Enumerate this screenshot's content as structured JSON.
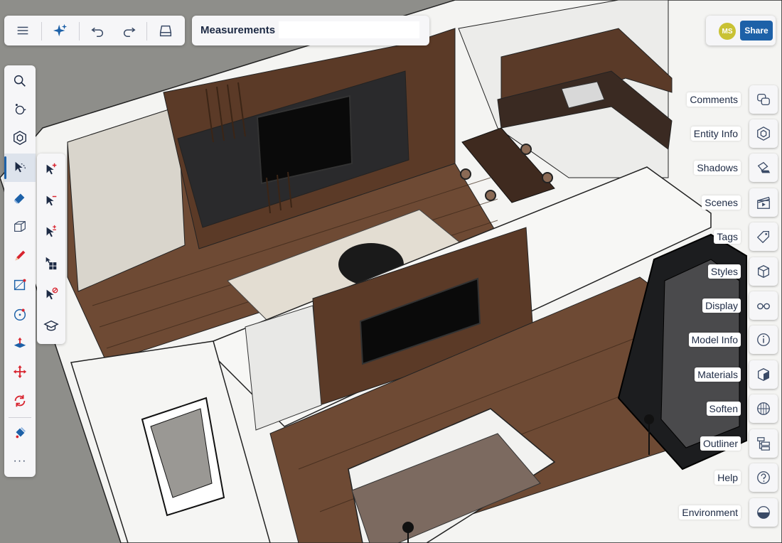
{
  "toolbar": {
    "menu_icon": "hamburger-menu-icon",
    "ai_icon": "sparkles-icon",
    "undo_icon": "undo-icon",
    "redo_icon": "redo-icon",
    "save_icon": "save-tray-icon"
  },
  "measurements": {
    "label": "Measurements",
    "value": ""
  },
  "account": {
    "initials": "MS",
    "share_label": "Share",
    "accent_color": "#1d61a8",
    "avatar_color": "#c9c234"
  },
  "tools": [
    "search-icon",
    "orbit-icon",
    "component-icon",
    "select-icon",
    "eraser-icon",
    "box-icon",
    "pencil-icon",
    "rectangle-icon",
    "circle-icon",
    "push-pull-icon",
    "move-icon",
    "rotate-icon",
    "paint-bucket-icon",
    "more-icon"
  ],
  "tools_more": "···",
  "select_subtools": [
    "select-add-icon",
    "select-subtract-icon",
    "select-toggle-icon",
    "select-all-icon",
    "select-none-icon",
    "select-learn-icon"
  ],
  "right_panels": [
    {
      "label": "Comments",
      "icon": "comments-icon"
    },
    {
      "label": "Entity Info",
      "icon": "entity-info-icon"
    },
    {
      "label": "Shadows",
      "icon": "shadows-icon"
    },
    {
      "label": "Scenes",
      "icon": "scenes-icon"
    },
    {
      "label": "Tags",
      "icon": "tags-icon"
    },
    {
      "label": "Styles",
      "icon": "styles-icon"
    },
    {
      "label": "Display",
      "icon": "glasses-icon"
    },
    {
      "label": "Model Info",
      "icon": "info-icon"
    },
    {
      "label": "Materials",
      "icon": "materials-icon"
    },
    {
      "label": "Soften",
      "icon": "soften-icon"
    },
    {
      "label": "Outliner",
      "icon": "outliner-icon"
    },
    {
      "label": "Help",
      "icon": "help-icon"
    },
    {
      "label": "Environment",
      "icon": "environment-icon"
    }
  ]
}
